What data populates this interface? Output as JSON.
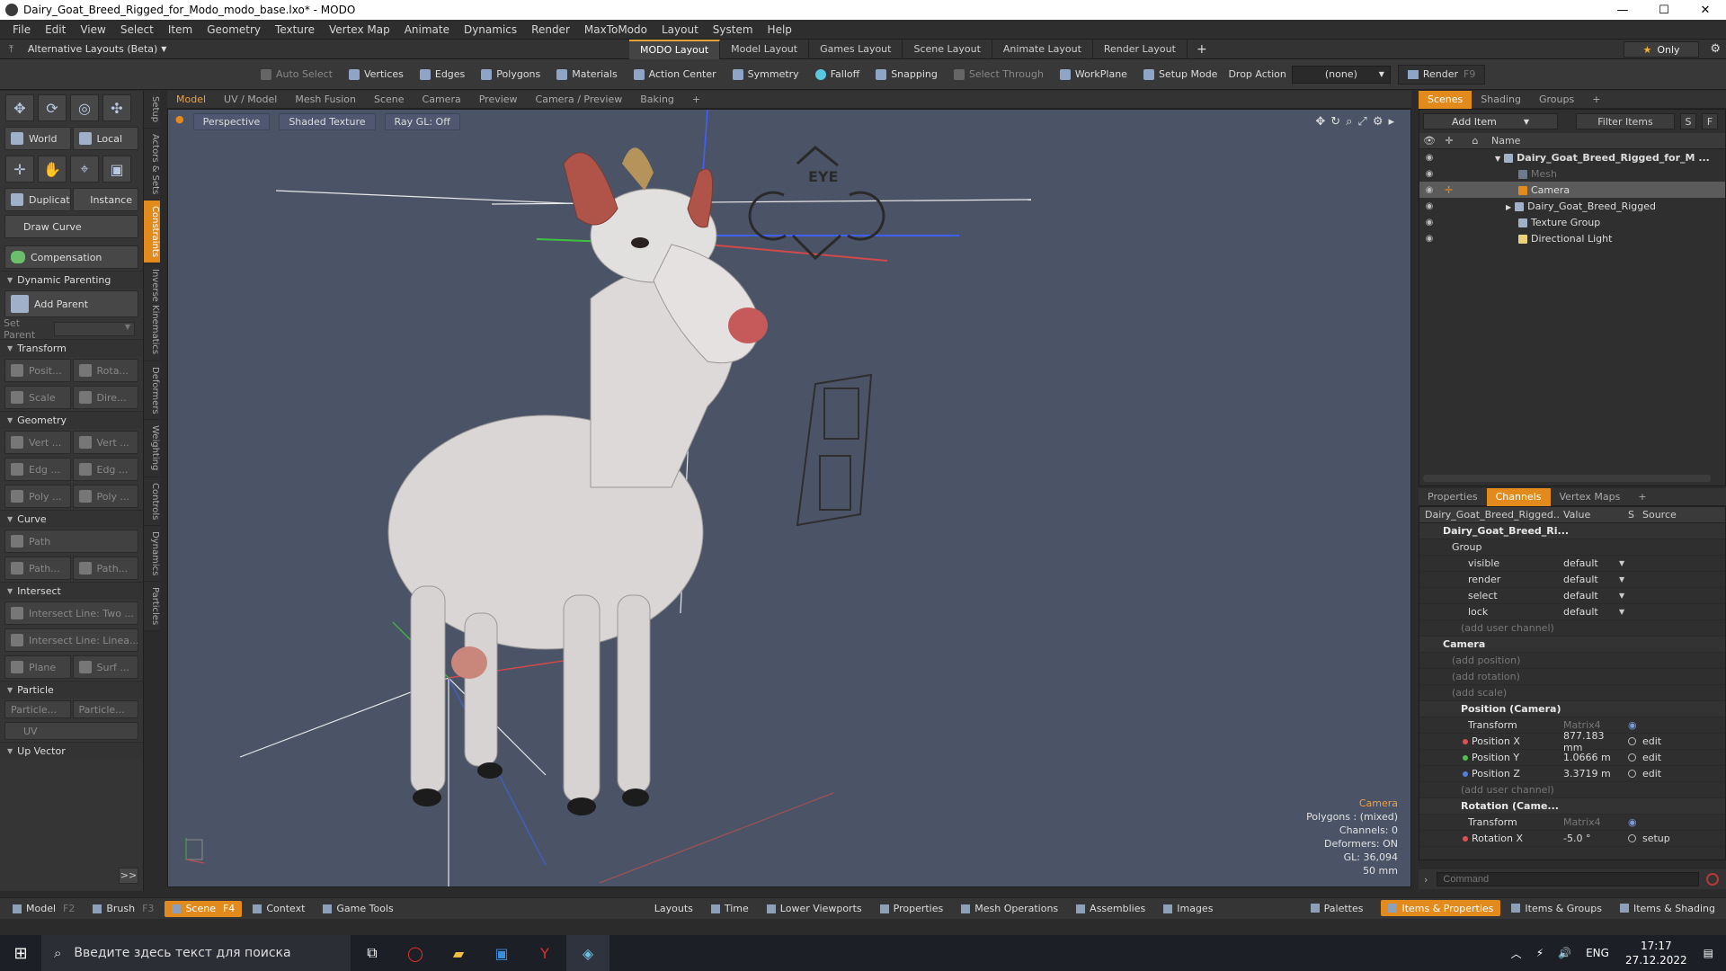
{
  "window": {
    "title": "Dairy_Goat_Breed_Rigged_for_Modo_modo_base.lxo* - MODO",
    "min": "—",
    "max": "☐",
    "close": "✕"
  },
  "menu": [
    "File",
    "Edit",
    "View",
    "Select",
    "Item",
    "Geometry",
    "Texture",
    "Vertex Map",
    "Animate",
    "Dynamics",
    "Render",
    "MaxToModo",
    "Layout",
    "System",
    "Help"
  ],
  "layoutbar": {
    "alt_layout": "Alternative Layouts (Beta)",
    "tabs": [
      "MODO Layout",
      "Model Layout",
      "Games Layout",
      "Scene Layout",
      "Animate Layout",
      "Render Layout"
    ],
    "active_tab": "MODO Layout",
    "only": "Only"
  },
  "toolbar": {
    "items": [
      "Auto Select",
      "Vertices",
      "Edges",
      "Polygons",
      "Materials",
      "Action Center",
      "Symmetry",
      "Falloff",
      "Snapping",
      "Select Through",
      "WorkPlane",
      "Setup Mode"
    ],
    "drop_action_label": "Drop Action",
    "drop_action_value": "(none)",
    "render": "Render",
    "render_key": "F9"
  },
  "leftpanel": {
    "world": "World",
    "local": "Local",
    "duplicate": "Duplicate",
    "instance": "Instance",
    "draw_curve": "Draw Curve",
    "compensation": "Compensation",
    "dynamic_parenting": "Dynamic Parenting",
    "add_parent": "Add Parent",
    "set_parent": "Set Parent",
    "sections": {
      "transform": "Transform",
      "geometry": "Geometry",
      "curve": "Curve",
      "intersect": "Intersect",
      "particle": "Particle",
      "up_vector": "Up Vector"
    },
    "transform_btns": [
      "Posit...",
      "Rota...",
      "Scale",
      "Dire..."
    ],
    "geometry_btns": [
      "Vert ...",
      "Vert ...",
      "Edg ...",
      "Edg ...",
      "Poly ...",
      "Poly ..."
    ],
    "curve_btns": [
      "Path",
      "Path...",
      "Path..."
    ],
    "intersect_btns": [
      "Intersect Line: Two ...",
      "Intersect Line: Linea...",
      "Plane",
      "Surf ..."
    ],
    "particle_btns": [
      "Particle...",
      "Particle...",
      "UV"
    ],
    "expand": ">>",
    "side_tabs": [
      "Setup",
      "Actors & Sets",
      "Constraints",
      "Inverse Kinematics",
      "Deformers",
      "Weighting",
      "Controls",
      "Dynamics",
      "Particles"
    ],
    "active_side_tab": "Constraints"
  },
  "viewport": {
    "tabs": [
      "Model",
      "UV / Model",
      "Mesh Fusion",
      "Scene",
      "Camera",
      "Preview",
      "Camera / Preview",
      "Baking"
    ],
    "active_tab": "Model",
    "chips": [
      "Perspective",
      "Shaded Texture",
      "Ray GL: Off"
    ],
    "info": {
      "camera": "Camera",
      "polygons": "Polygons : (mixed)",
      "channels": "Channels: 0",
      "deformers": "Deformers: ON",
      "gl": "GL: 36,094",
      "focal": "50 mm"
    },
    "eye_label": "EYE"
  },
  "scenes": {
    "tabs": [
      "Scenes",
      "Shading",
      "Groups"
    ],
    "active_tab": "Scenes",
    "add_item": "Add Item",
    "filter": "Filter Items",
    "s": "S",
    "f": "F",
    "col_name": "Name",
    "items": [
      {
        "label": "Dairy_Goat_Breed_Rigged_for_M ...",
        "indent": 0,
        "bold": true
      },
      {
        "label": "Mesh",
        "indent": 1,
        "muted": true
      },
      {
        "label": "Camera",
        "indent": 1,
        "selected": true
      },
      {
        "label": "Dairy_Goat_Breed_Rigged",
        "indent": 1
      },
      {
        "label": "Texture Group",
        "indent": 1
      },
      {
        "label": "Directional Light",
        "indent": 1
      }
    ]
  },
  "channels": {
    "tabs": [
      "Properties",
      "Channels",
      "Vertex Maps"
    ],
    "active_tab": "Channels",
    "col_item": "Dairy_Goat_Breed_Rigged...",
    "col_value": "Value",
    "col_s": "S",
    "col_source": "Source",
    "rows": [
      {
        "name": "Dairy_Goat_Breed_Ri...",
        "indent": 1,
        "type": "hdr"
      },
      {
        "name": "Group",
        "indent": 2,
        "type": "hdr2"
      },
      {
        "name": "visible",
        "indent": 3,
        "value": "default",
        "dd": true
      },
      {
        "name": "render",
        "indent": 3,
        "value": "default",
        "dd": true
      },
      {
        "name": "select",
        "indent": 3,
        "value": "default",
        "dd": true
      },
      {
        "name": "lock",
        "indent": 3,
        "value": "default",
        "dd": true
      },
      {
        "name": "(add user channel)",
        "indent": 3,
        "muted": true
      },
      {
        "name": "Camera",
        "indent": 1,
        "type": "hdr"
      },
      {
        "name": "(add position)",
        "indent": 2,
        "muted": true
      },
      {
        "name": "(add rotation)",
        "indent": 2,
        "muted": true
      },
      {
        "name": "(add scale)",
        "indent": 2,
        "muted": true
      },
      {
        "name": "Position (Camera)",
        "indent": 2,
        "type": "hdr"
      },
      {
        "name": "Transform",
        "indent": 3,
        "value": "Matrix4",
        "muted_value": true,
        "link": true
      },
      {
        "name": "Position X",
        "indent": 3,
        "value": "877.183 mm",
        "src": "edit",
        "axis": "#e05050"
      },
      {
        "name": "Position Y",
        "indent": 3,
        "value": "1.0666 m",
        "src": "edit",
        "axis": "#50c050"
      },
      {
        "name": "Position Z",
        "indent": 3,
        "value": "3.3719 m",
        "src": "edit",
        "axis": "#5080e0"
      },
      {
        "name": "(add user channel)",
        "indent": 3,
        "muted": true
      },
      {
        "name": "Rotation (Came...",
        "indent": 2,
        "type": "hdr"
      },
      {
        "name": "Transform",
        "indent": 3,
        "value": "Matrix4",
        "muted_value": true,
        "link": true
      },
      {
        "name": "Rotation X",
        "indent": 3,
        "value": "-5.0 °",
        "src": "setup",
        "axis": "#e05050"
      }
    ]
  },
  "command": {
    "placeholder": "Command"
  },
  "bottombar": {
    "left": [
      {
        "label": "Model",
        "key": "F2"
      },
      {
        "label": "Brush",
        "key": "F3"
      },
      {
        "label": "Scene",
        "key": "F4",
        "active": true
      },
      {
        "label": "Context"
      },
      {
        "label": "Game Tools"
      }
    ],
    "middle": [
      "Layouts",
      "Time",
      "Lower Viewports",
      "Properties",
      "Mesh Operations",
      "Assemblies",
      "Images"
    ],
    "right": [
      {
        "label": "Palettes"
      },
      {
        "label": "Items & Properties",
        "active": true
      },
      {
        "label": "Items & Groups"
      },
      {
        "label": "Items & Shading"
      }
    ]
  },
  "taskbar": {
    "search_placeholder": "Введите здесь текст для поиска",
    "lang": "ENG",
    "time": "17:17",
    "date": "27.12.2022"
  },
  "colors": {
    "accent": "#e38a1d",
    "viewport_bg": "#4b5467",
    "panel_bg": "#353535"
  }
}
